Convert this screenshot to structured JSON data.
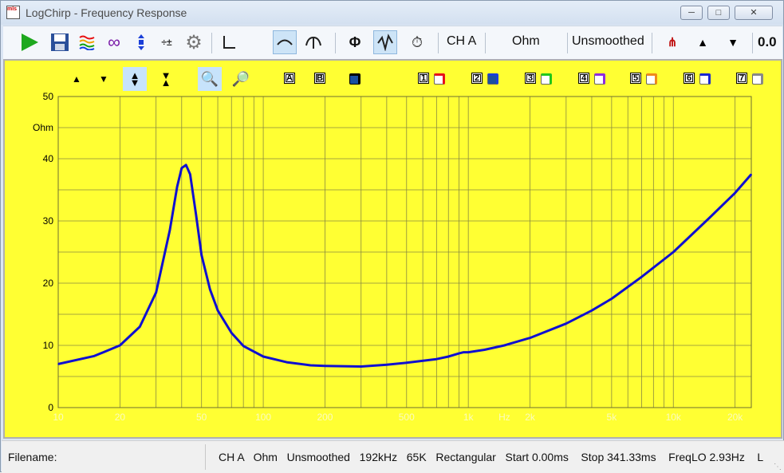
{
  "window": {
    "title": "LogChirp - Frequency Response",
    "icon_text": "mls"
  },
  "toolbar": {
    "channel": "CH A",
    "unit": "Ohm",
    "smoothing": "Unsmoothed",
    "value_readout": "0.0"
  },
  "plot_controls": {
    "label_a": "A",
    "label_b": "B"
  },
  "traces": [
    {
      "num": "1",
      "color": "#e8101a",
      "checked": false
    },
    {
      "num": "2",
      "color": "#1a3fd8",
      "checked": true
    },
    {
      "num": "3",
      "color": "#21c81a",
      "checked": false
    },
    {
      "num": "4",
      "color": "#8f2ae0",
      "checked": false
    },
    {
      "num": "5",
      "color": "#f08a1a",
      "checked": false
    },
    {
      "num": "6",
      "color": "#1a28d0",
      "checked": false
    },
    {
      "num": "7",
      "color": "#888888",
      "checked": false
    }
  ],
  "chart_data": {
    "type": "line",
    "x_scale": "log",
    "xlim": [
      10,
      24000
    ],
    "ylim": [
      0,
      50
    ],
    "ylabel": "Ohm",
    "x_unit": "Hz",
    "y_ticks": [
      "50",
      "40",
      "30",
      "20",
      "10",
      "0"
    ],
    "x_ticks": [
      "10",
      "20",
      "50",
      "100",
      "200",
      "500",
      "1k",
      "2k",
      "5k",
      "10k",
      "20k"
    ],
    "grid": true,
    "background": "#ffff33",
    "series": [
      {
        "color": "#1010d0",
        "x": [
          10,
          15,
          20,
          25,
          30,
          35,
          38,
          40,
          42,
          44,
          47,
          50,
          55,
          60,
          70,
          80,
          100,
          130,
          170,
          200,
          300,
          400,
          500,
          700,
          800,
          900,
          950,
          1000,
          1200,
          1500,
          2000,
          3000,
          4000,
          5000,
          7000,
          10000,
          15000,
          20000,
          24000
        ],
        "y": [
          7.0,
          8.3,
          10.0,
          13.0,
          18.5,
          28.5,
          35.5,
          38.5,
          39.0,
          37.5,
          31.0,
          24.5,
          19.0,
          15.6,
          12.0,
          9.9,
          8.2,
          7.3,
          6.8,
          6.7,
          6.6,
          6.9,
          7.2,
          7.8,
          8.2,
          8.7,
          8.9,
          8.9,
          9.3,
          10.0,
          11.2,
          13.5,
          15.6,
          17.5,
          21.0,
          25.0,
          30.5,
          34.5,
          37.5
        ]
      }
    ]
  },
  "status": {
    "filename_label": "Filename:",
    "details": "CH A   Ohm   Unsmoothed   192kHz   65K   Rectangular   Start 0.00ms    Stop 341.33ms    FreqLO 2.93Hz    L"
  }
}
